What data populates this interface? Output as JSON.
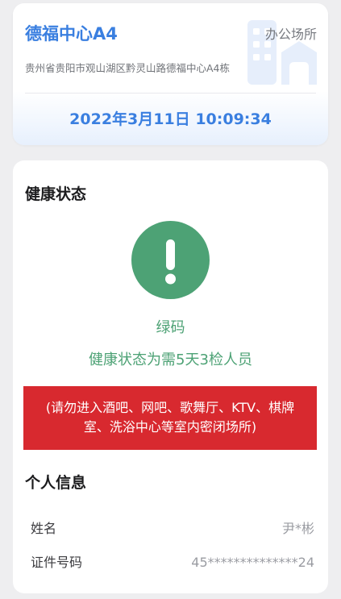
{
  "place": {
    "name": "德福中心A4",
    "type": "办公场所",
    "address": "贵州省贵阳市观山湖区黔灵山路德福中心A4栋",
    "datetime": "2022年3月11日 10:09:34"
  },
  "health": {
    "section_title": "健康状态",
    "code_name": "绿码",
    "status_text": "健康状态为需5天3检人员",
    "status_color": "#4da275",
    "warning_line1": "(请勿进入酒吧、网吧、歌舞厅、KTV、棋牌",
    "warning_line2": "室、洗浴中心等室内密闭场所)",
    "warning_color": "#d8292f"
  },
  "personal": {
    "section_title": "个人信息",
    "rows": [
      {
        "label": "姓名",
        "value": "尹*彬"
      },
      {
        "label": "证件号码",
        "value": "45**************24"
      }
    ]
  },
  "icons": {
    "building": "building-icon",
    "status": "exclamation-icon"
  },
  "colors": {
    "accent_blue": "#3a7fe0"
  }
}
